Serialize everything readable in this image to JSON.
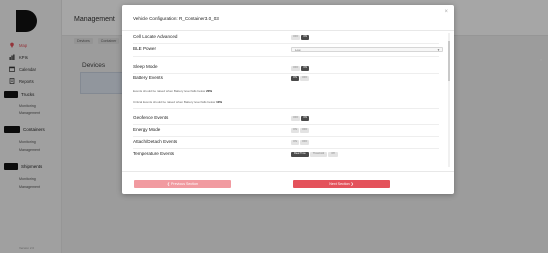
{
  "sidebar": {
    "items": [
      {
        "label": "Map",
        "icon": "map-pin-icon",
        "color": "#e4525b"
      },
      {
        "label": "KPIs",
        "icon": "chart-icon"
      },
      {
        "label": "Calendar",
        "icon": "calendar-icon"
      },
      {
        "label": "Reports",
        "icon": "reports-icon"
      }
    ],
    "sections": [
      {
        "label": "Trucks",
        "links": [
          "Monitoring",
          "Management"
        ]
      },
      {
        "label": "Containers",
        "links": [
          "Monitoring",
          "Management"
        ]
      },
      {
        "label": "Shipments",
        "links": [
          "Monitoring",
          "Management"
        ]
      }
    ],
    "footer": "Version 2.0"
  },
  "header": {
    "title": "Management"
  },
  "breadcrumbs": [
    "Devices",
    "Container"
  ],
  "devices_label": "Devices",
  "modal": {
    "title": "Vehicle Configuration: R_Container3.0_03",
    "close": "×",
    "cell_locate": {
      "label": "Cell Locate Advanced",
      "off": "OFF",
      "on": "ON"
    },
    "ble_power": {
      "label": "BLE Power",
      "value": "Low"
    },
    "sleep_mode": {
      "label": "Sleep Mode",
      "off": "OFF",
      "on": "ON"
    },
    "battery_events": {
      "label": "Battery Events",
      "on": "ON",
      "off": "OFF",
      "hint1": "Events should be raised when Battery level falls below",
      "hint1_value": "20%",
      "hint2": "Critical Events should be raised when Battery level falls below",
      "hint2_value": "10%"
    },
    "geofence": {
      "label": "Geofence Events",
      "off": "OFF",
      "on": "ON"
    },
    "energy": {
      "label": "Energy Mode",
      "a": "ON",
      "b": "OFF"
    },
    "attach": {
      "label": "Attach/Detach Events",
      "a": "ON",
      "b": "OFF"
    },
    "temperature": {
      "label": "Temperature Events",
      "opts": [
        "Real Time",
        "Threshold",
        "Off"
      ]
    },
    "prev_button": "Previous Section",
    "next_button": "Next Section"
  },
  "colors": {
    "accent": "#e4525b",
    "accent_light": "#f19aa0",
    "dark": "#4a4a4a"
  }
}
